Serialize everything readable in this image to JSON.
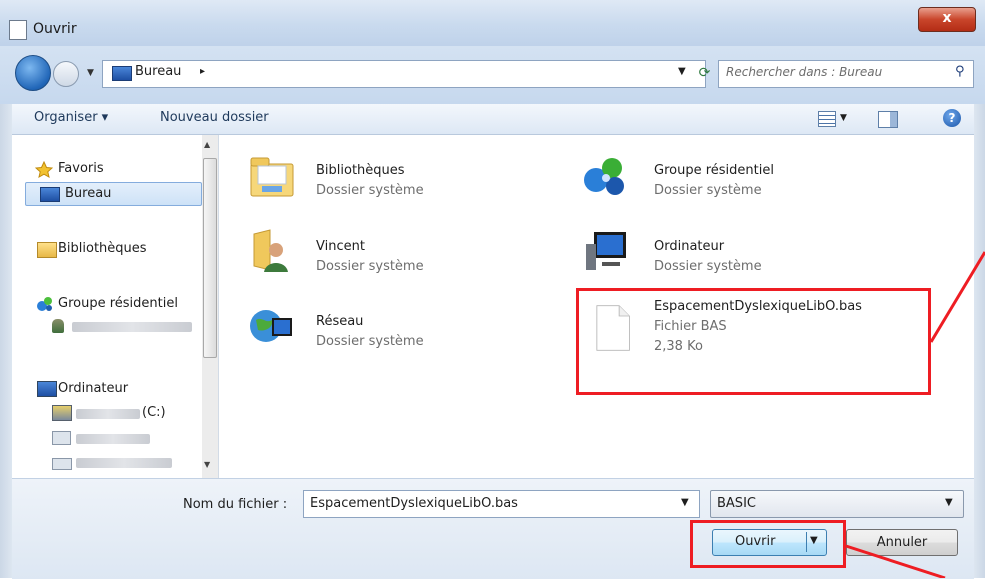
{
  "window": {
    "title": "Ouvrir",
    "close_label": "x"
  },
  "address": {
    "path": "Bureau",
    "path_sep": "▸",
    "search_placeholder": "Rechercher dans : Bureau"
  },
  "toolbar": {
    "organize": "Organiser ▾",
    "new_folder": "Nouveau dossier",
    "help": "?"
  },
  "nav": {
    "favorites": "Favoris",
    "bureau": "Bureau",
    "libraries": "Bibliothèques",
    "homegroup": "Groupe résidentiel",
    "computer": "Ordinateur",
    "drive_c_suffix": "(C:)"
  },
  "items": [
    {
      "name": "Bibliothèques",
      "type": "Dossier système"
    },
    {
      "name": "Groupe résidentiel",
      "type": "Dossier système"
    },
    {
      "name": "Vincent",
      "type": "Dossier système"
    },
    {
      "name": "Ordinateur",
      "type": "Dossier système"
    },
    {
      "name": "Réseau",
      "type": "Dossier système"
    },
    {
      "name": "EspacementDyslexiqueLibO.bas",
      "type": "Fichier BAS",
      "size": "2,38 Ko"
    }
  ],
  "bottom": {
    "filename_label": "Nom du fichier :",
    "filename_value": "EspacementDyslexiqueLibO.bas",
    "filetype_value": "BASIC",
    "open_label": "Ouvrir",
    "cancel_label": "Annuler"
  },
  "colors": {
    "annotation_red": "#ee1d23",
    "chrome_blue": "#c9daee"
  }
}
